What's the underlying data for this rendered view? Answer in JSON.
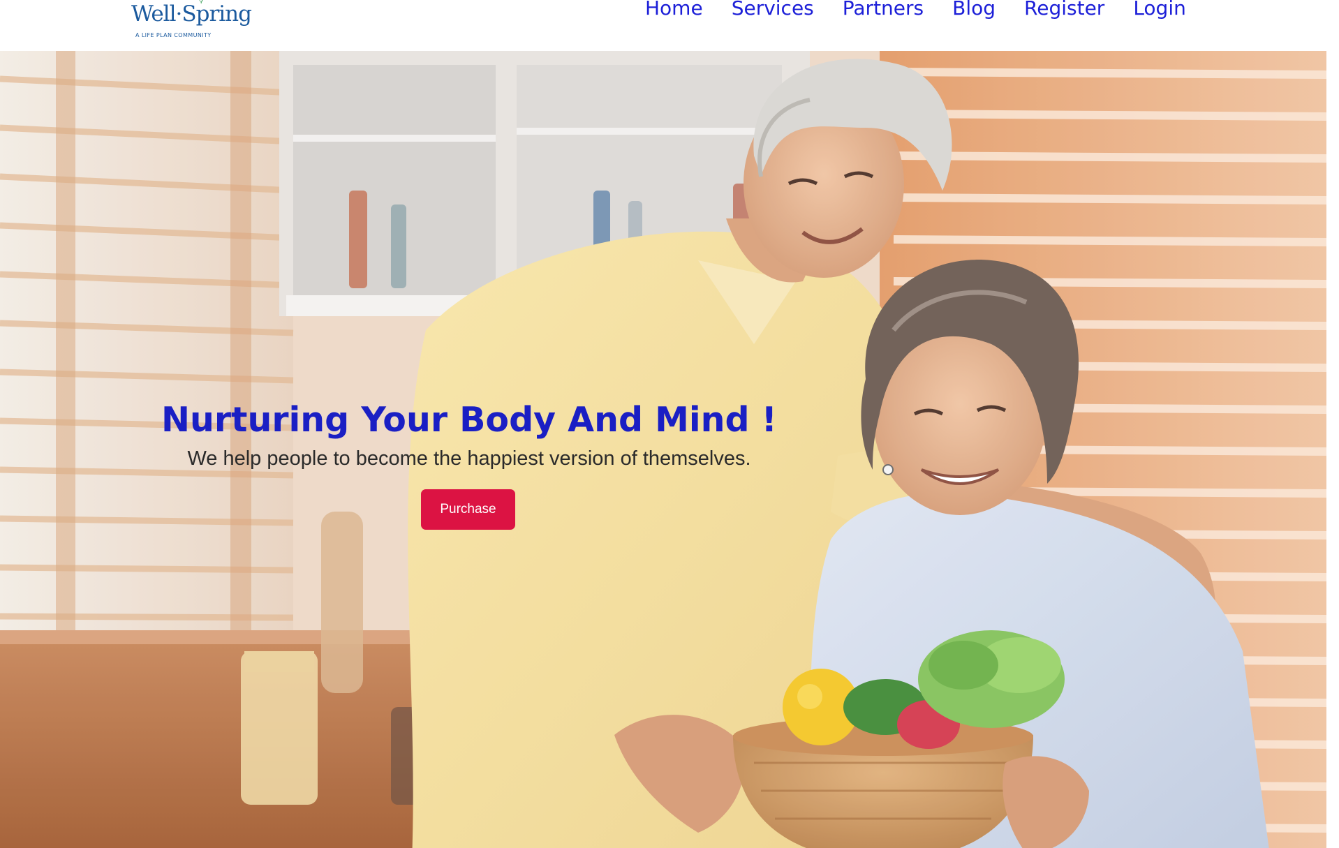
{
  "header": {
    "logo": {
      "name": "Well·Spring",
      "tagline": "A LIFE PLAN COMMUNITY",
      "icon": "sprout-icon"
    },
    "nav": [
      {
        "label": "Home"
      },
      {
        "label": "Services"
      },
      {
        "label": "Partners"
      },
      {
        "label": "Blog"
      },
      {
        "label": "Register"
      },
      {
        "label": "Login"
      }
    ]
  },
  "hero": {
    "title": "Nurturing Your Body And Mind !",
    "subtitle": "We help people to become the happiest version of themselves.",
    "cta_label": "Purchase",
    "image": "photo of smiling senior couple in a kitchen holding a bowl of vegetables"
  },
  "colors": {
    "nav_link": "#1c1fd8",
    "hero_title": "#1a1fc4",
    "cta_background": "#dc1343",
    "logo": "#1b5a9e"
  }
}
